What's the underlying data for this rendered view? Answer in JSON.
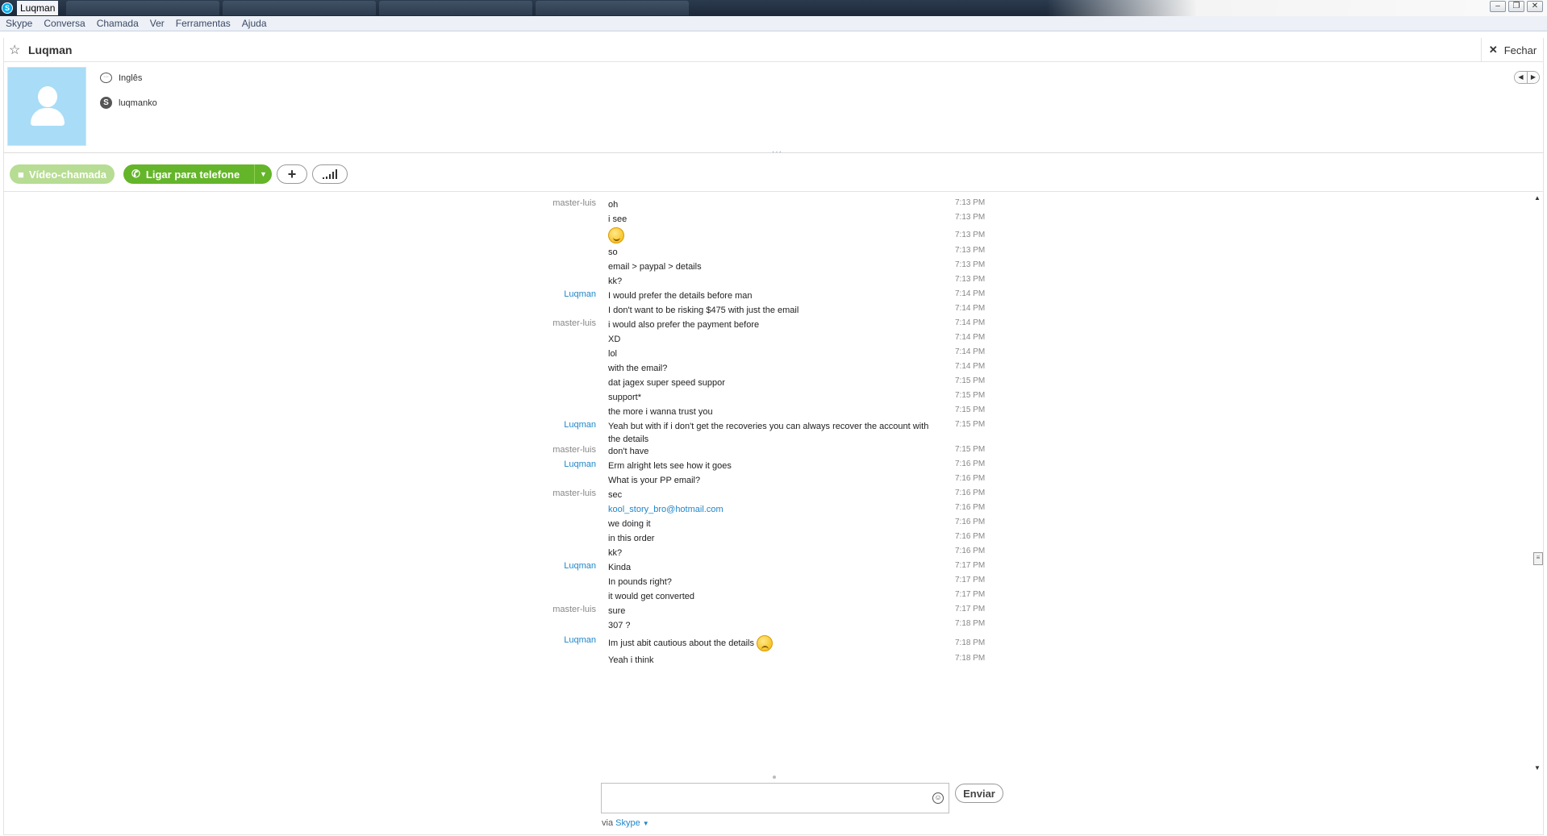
{
  "window": {
    "title": "Luqman",
    "app_icon": "S",
    "controls": {
      "minimize": "–",
      "restore": "❐",
      "close": "✕"
    }
  },
  "menu": [
    "Skype",
    "Conversa",
    "Chamada",
    "Ver",
    "Ferramentas",
    "Ajuda"
  ],
  "header": {
    "contact_name": "Luqman",
    "close_label": "Fechar"
  },
  "profile": {
    "language": "Inglês",
    "skype_name": "luqmanko"
  },
  "toolbar": {
    "video_label": "Vídeo-chamada",
    "call_label": "Ligar para telefone"
  },
  "messages": [
    {
      "sender": "master-luis",
      "text": "oh",
      "time": "7:13 PM"
    },
    {
      "sender": "",
      "text": "i see",
      "time": "7:13 PM"
    },
    {
      "sender": "",
      "text": "",
      "emoticon": "wink-smiley-icon",
      "time": "7:13 PM"
    },
    {
      "sender": "",
      "text": "so",
      "time": "7:13 PM"
    },
    {
      "sender": "",
      "text": "email > paypal > details",
      "time": "7:13 PM"
    },
    {
      "sender": "",
      "text": "kk?",
      "time": "7:13 PM"
    },
    {
      "sender": "Luqman",
      "text": "I would prefer the details before man",
      "time": "7:14 PM"
    },
    {
      "sender": "",
      "text": "I don't want to be risking $475 with just the email",
      "time": "7:14 PM"
    },
    {
      "sender": "master-luis",
      "text": "i would also prefer the payment before",
      "time": "7:14 PM"
    },
    {
      "sender": "",
      "text": "XD",
      "time": "7:14 PM"
    },
    {
      "sender": "",
      "text": "lol",
      "time": "7:14 PM"
    },
    {
      "sender": "",
      "text": "with the email?",
      "time": "7:14 PM"
    },
    {
      "sender": "",
      "text": "dat jagex super speed suppor",
      "time": "7:15 PM"
    },
    {
      "sender": "",
      "text": "support*",
      "time": "7:15 PM"
    },
    {
      "sender": "",
      "text": "the more i wanna trust you",
      "time": "7:15 PM"
    },
    {
      "sender": "Luqman",
      "text": "Yeah but with if i don't get the recoveries you can always recover the account with the details",
      "time": "7:15 PM"
    },
    {
      "sender": "master-luis",
      "text": "don't have",
      "time": "7:15 PM"
    },
    {
      "sender": "Luqman",
      "text": "Erm alright lets see how it goes",
      "time": "7:16 PM"
    },
    {
      "sender": "",
      "text": "What is your PP email?",
      "time": "7:16 PM"
    },
    {
      "sender": "master-luis",
      "text": "sec",
      "time": "7:16 PM"
    },
    {
      "sender": "",
      "text": "kool_story_bro@hotmail.com",
      "link": true,
      "time": "7:16 PM"
    },
    {
      "sender": "",
      "text": "we doing it",
      "time": "7:16 PM"
    },
    {
      "sender": "",
      "text": "in this order",
      "time": "7:16 PM"
    },
    {
      "sender": "",
      "text": "kk?",
      "time": "7:16 PM"
    },
    {
      "sender": "Luqman",
      "text": "Kinda",
      "time": "7:17 PM"
    },
    {
      "sender": "",
      "text": "In pounds right?",
      "time": "7:17 PM"
    },
    {
      "sender": "",
      "text": "it would get converted",
      "time": "7:17 PM"
    },
    {
      "sender": "master-luis",
      "text": "sure",
      "time": "7:17 PM"
    },
    {
      "sender": "",
      "text": "307 ?",
      "time": "7:18 PM"
    },
    {
      "sender": "Luqman",
      "text": "Im just abit cautious about the details",
      "emoticon": "worried-smiley-icon",
      "time": "7:18 PM"
    },
    {
      "sender": "",
      "text": "Yeah i think",
      "time": "7:18 PM"
    }
  ],
  "composer": {
    "value": "",
    "send_label": "Enviar",
    "via_prefix": "via",
    "via_service": "Skype"
  },
  "colors": {
    "skype_blue": "#00aff0",
    "call_green": "#64b52a",
    "video_green_disabled": "#b7dc93",
    "link_blue": "#1f86c9"
  }
}
